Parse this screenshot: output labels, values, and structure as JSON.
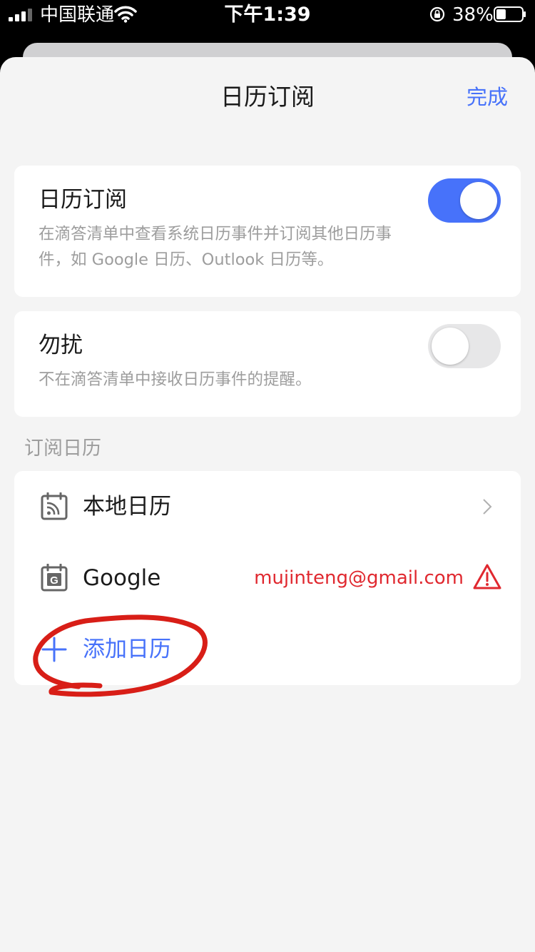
{
  "status_bar": {
    "carrier": "中国联通",
    "time": "下午1:39",
    "battery": "38%",
    "battery_level": 0.38
  },
  "header": {
    "title": "日历订阅",
    "done_label": "完成"
  },
  "subscription": {
    "title": "日历订阅",
    "description": "在滴答清单中查看系统日历事件并订阅其他日历事件，如 Google 日历、Outlook 日历等。",
    "enabled": true
  },
  "dnd": {
    "title": "勿扰",
    "description": "不在滴答清单中接收日历事件的提醒。",
    "enabled": false
  },
  "calendars": {
    "section_label": "订阅日历",
    "items": [
      {
        "label": "本地日历",
        "icon": "rss-calendar-icon"
      },
      {
        "label": "Google",
        "icon": "google-calendar-icon",
        "account": "mujinteng@gmail.com",
        "status_icon": "warning-icon"
      }
    ],
    "add_label": "添加日历"
  },
  "colors": {
    "accent": "#4772fa",
    "error": "#e0282f",
    "annotation": "#d81e17"
  }
}
